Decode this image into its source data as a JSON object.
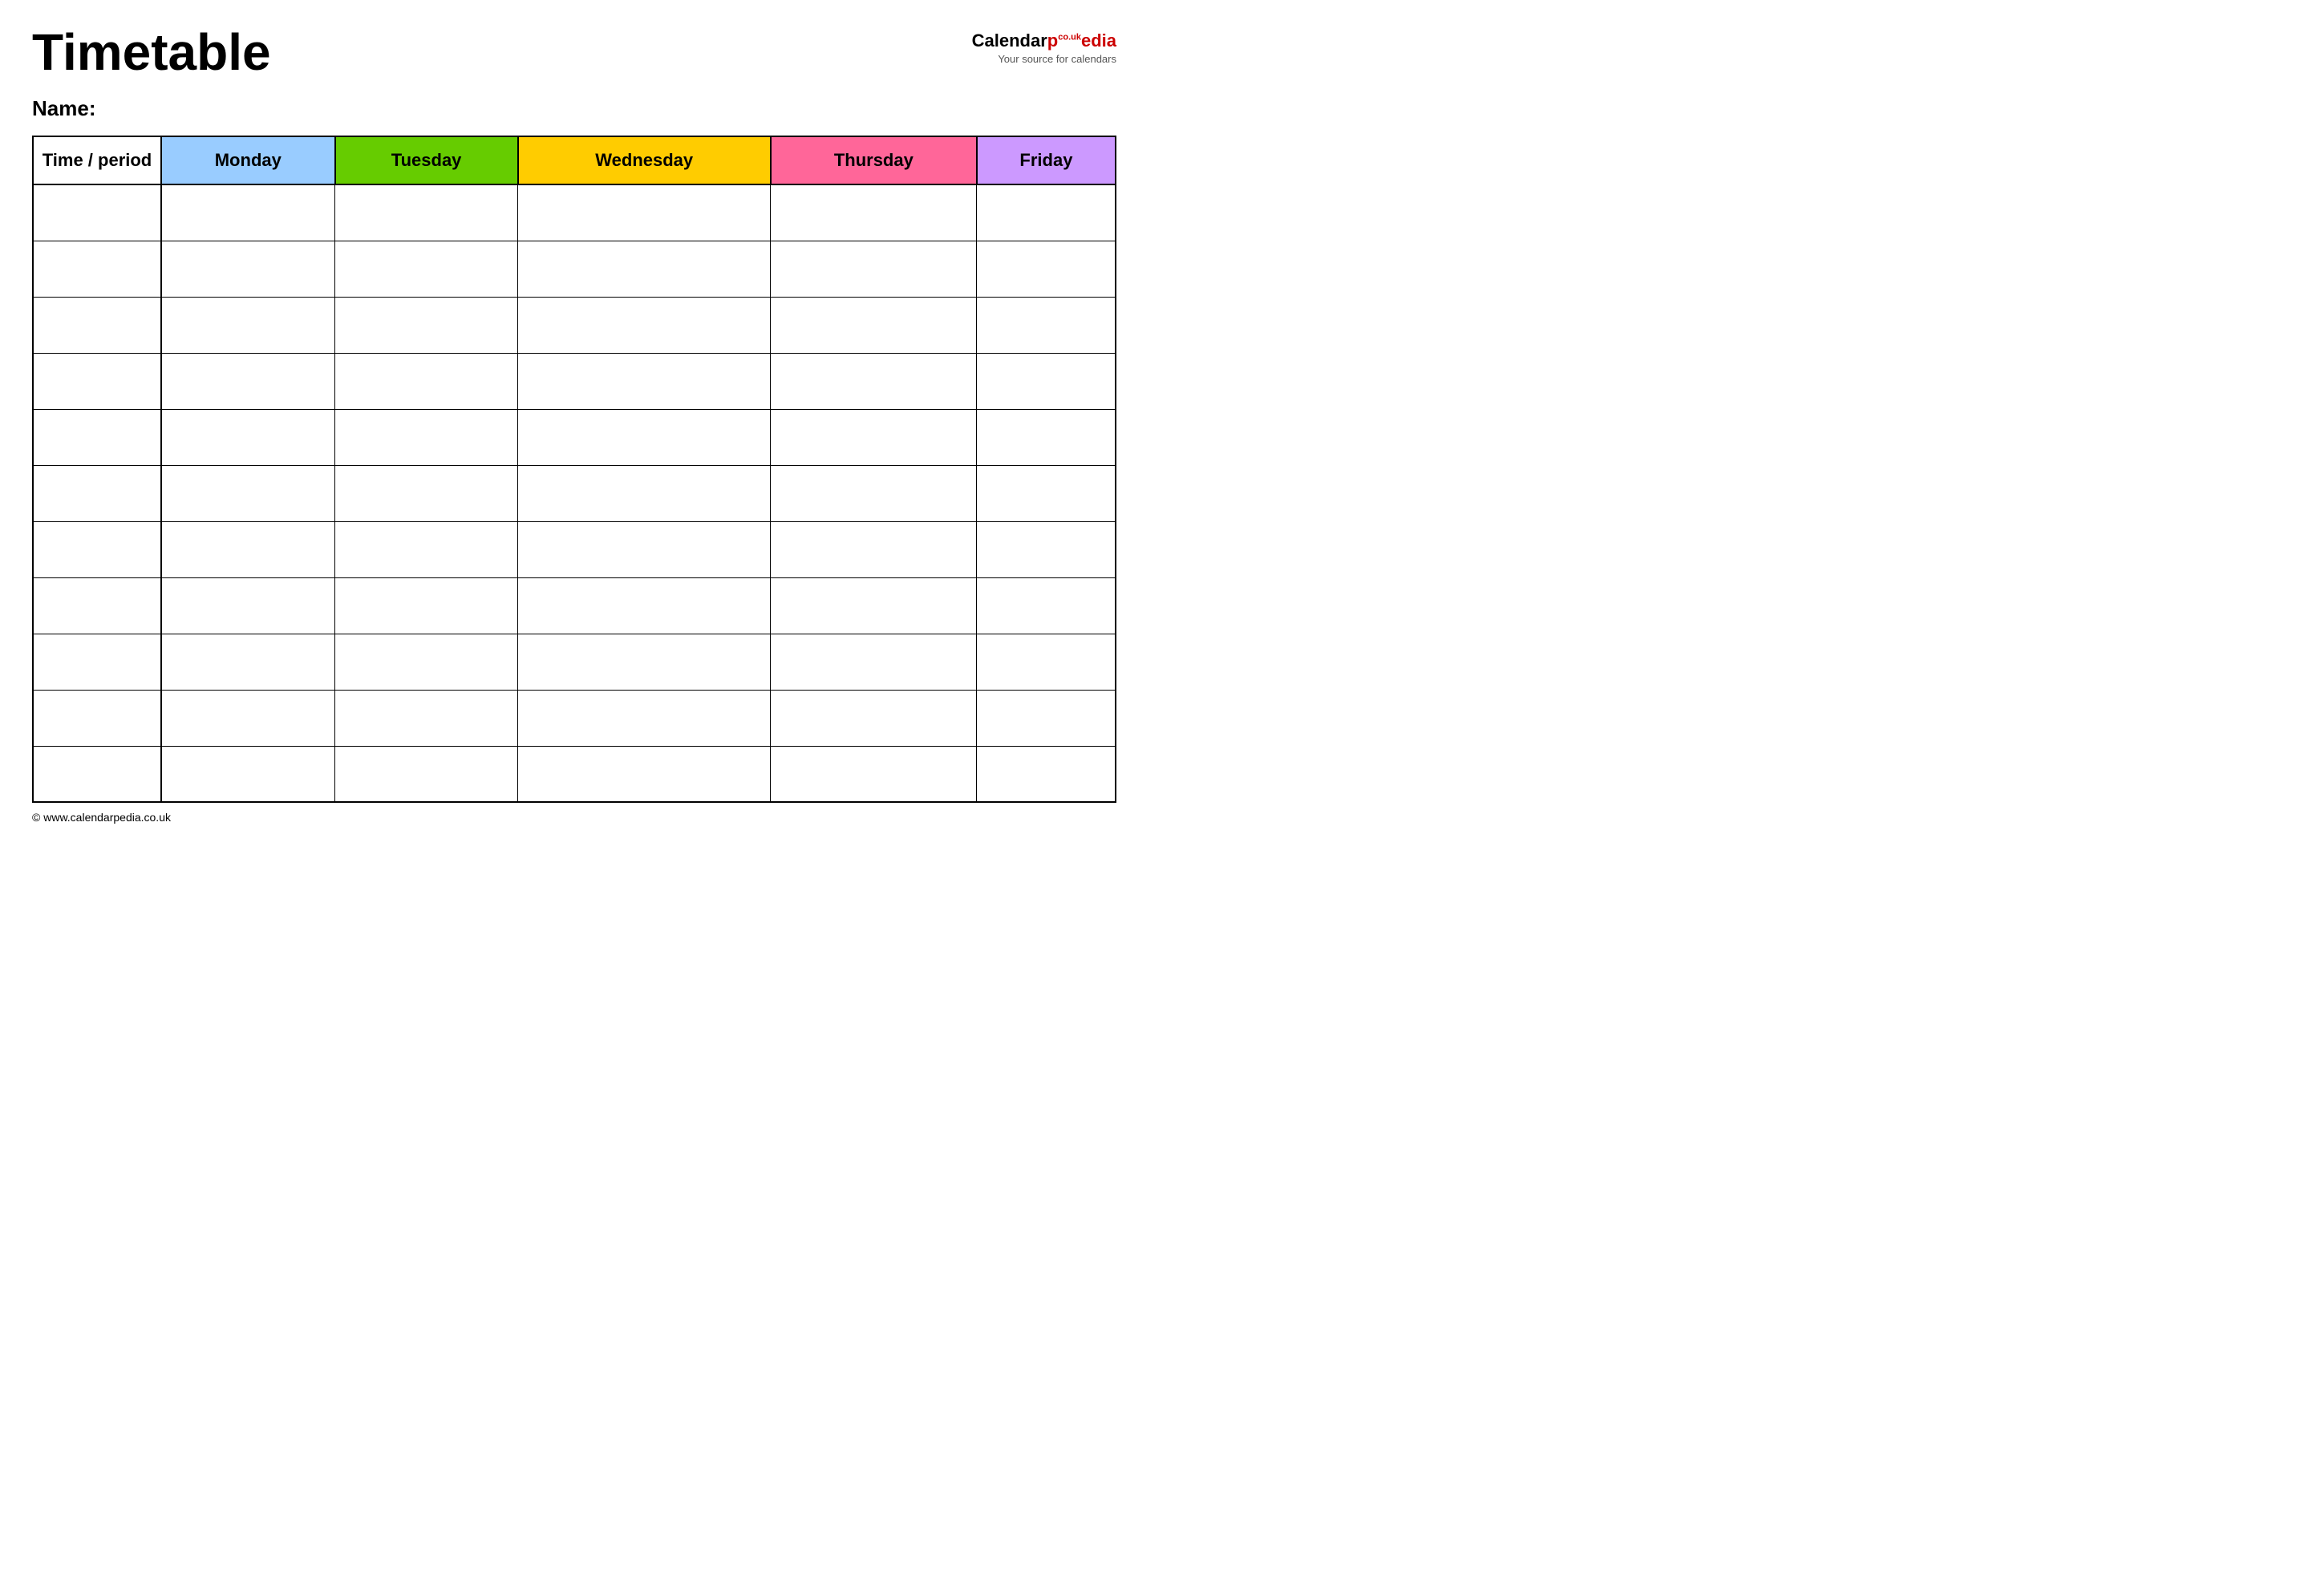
{
  "header": {
    "title": "Timetable",
    "logo": {
      "calendar": "Calendar",
      "pedia": "pedia",
      "co_uk": "co.uk",
      "tagline": "Your source for calendars"
    }
  },
  "name_label": "Name:",
  "table": {
    "headers": [
      {
        "label": "Time / period",
        "class": "th-time"
      },
      {
        "label": "Monday",
        "class": "th-monday"
      },
      {
        "label": "Tuesday",
        "class": "th-tuesday"
      },
      {
        "label": "Wednesday",
        "class": "th-wednesday"
      },
      {
        "label": "Thursday",
        "class": "th-thursday"
      },
      {
        "label": "Friday",
        "class": "th-friday"
      }
    ],
    "row_count": 11
  },
  "footer": {
    "url": "www.calendarpedia.co.uk"
  }
}
